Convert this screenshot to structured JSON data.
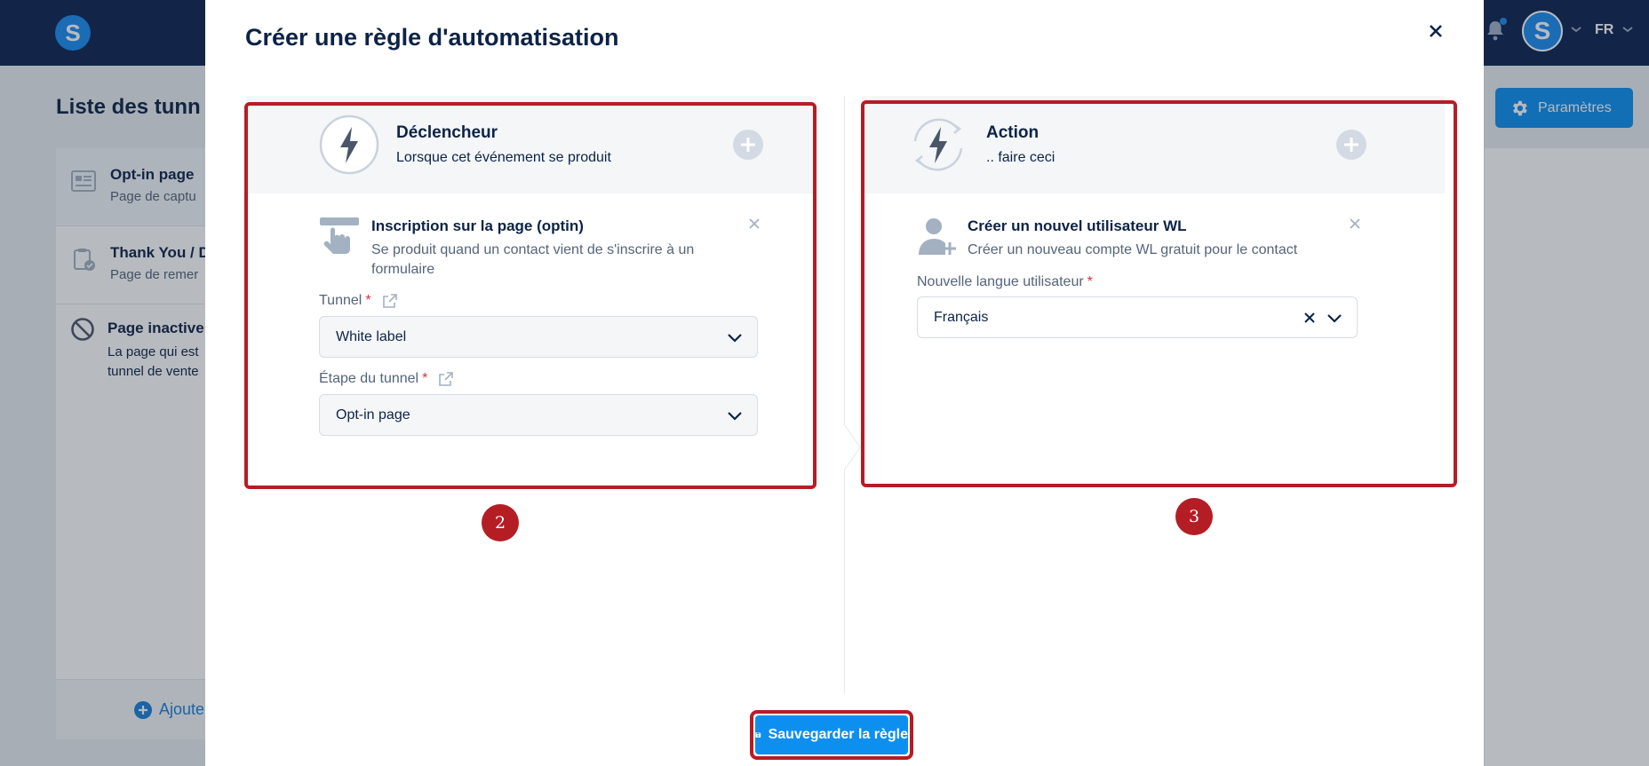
{
  "topbar": {
    "logo_letter": "S",
    "avatar_letter": "S",
    "language": "FR"
  },
  "background": {
    "page_title": "Liste des tunn",
    "settings_button": "Paramètres",
    "steps": [
      {
        "title": "Opt-in page",
        "subtitle": "Page de captu"
      },
      {
        "title": "Thank You / D",
        "subtitle": "Page de remer"
      }
    ],
    "inactive": {
      "title": "Page inactive",
      "description": "La page qui est tunnel de vente"
    },
    "add_label": "Ajoute"
  },
  "modal": {
    "title": "Créer une règle d'automatisation",
    "trigger": {
      "heading": "Déclencheur",
      "subheading": "Lorsque cet événement se produit",
      "card_title": "Inscription sur la page (optin)",
      "card_description": "Se produit quand un contact vient de s'inscrire à un formulaire",
      "tunnel_label": "Tunnel",
      "tunnel_value": "White label",
      "step_label": "Étape du tunnel",
      "step_value": "Opt-in page",
      "required_mark": "*"
    },
    "action": {
      "heading": "Action",
      "subheading": ".. faire ceci",
      "card_title": "Créer un nouvel utilisateur WL",
      "card_description": "Créer un nouveau compte WL gratuit pour le contact",
      "language_label": "Nouvelle langue utilisateur",
      "language_value": "Français",
      "required_mark": "*"
    },
    "markers": [
      "2",
      "3"
    ],
    "save_button": "Sauvegarder la règle"
  },
  "colors": {
    "primary": "#0d8ff0",
    "navy": "#0c2450",
    "highlight_red": "#b51d24",
    "required_red": "#e0303a"
  }
}
